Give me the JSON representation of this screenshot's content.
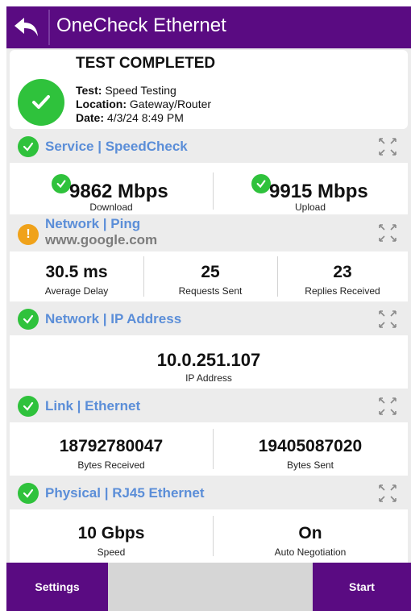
{
  "header": {
    "title": "OneCheck Ethernet"
  },
  "summary": {
    "status": "TEST COMPLETED",
    "test_label": "Test:",
    "test_value": "Speed Testing",
    "location_label": "Location:",
    "location_value": "Gateway/Router",
    "date_label": "Date:",
    "date_value": "4/3/24 8:49 PM"
  },
  "service": {
    "title": "Service | SpeedCheck",
    "download_value": "9862 Mbps",
    "download_label": "Download",
    "upload_value": "9915 Mbps",
    "upload_label": "Upload"
  },
  "ping": {
    "title": "Network | Ping",
    "host": "www.google.com",
    "delay_value": "30.5 ms",
    "delay_label": "Average Delay",
    "sent_value": "25",
    "sent_label": "Requests Sent",
    "recv_value": "23",
    "recv_label": "Replies Received"
  },
  "ip": {
    "title": "Network | IP Address",
    "value": "10.0.251.107",
    "label": "IP Address"
  },
  "link": {
    "title": "Link | Ethernet",
    "rx_value": "18792780047",
    "rx_label": "Bytes Received",
    "tx_value": "19405087020",
    "tx_label": "Bytes Sent"
  },
  "physical": {
    "title": "Physical | RJ45 Ethernet",
    "speed_value": "10 Gbps",
    "speed_label": "Speed",
    "autoneg_value": "On",
    "autoneg_label": "Auto Negotiation"
  },
  "footer": {
    "settings_label": "Settings",
    "start_label": "Start"
  },
  "colors": {
    "header": "#5a0b82",
    "ok": "#2fc23c",
    "warn": "#f0a21a",
    "section_title": "#5b8ed8"
  },
  "icons": {
    "back": "back-arrow-icon",
    "ok": "check-circle-icon",
    "warn": "warning-circle-icon",
    "expand": "expand-icon"
  }
}
